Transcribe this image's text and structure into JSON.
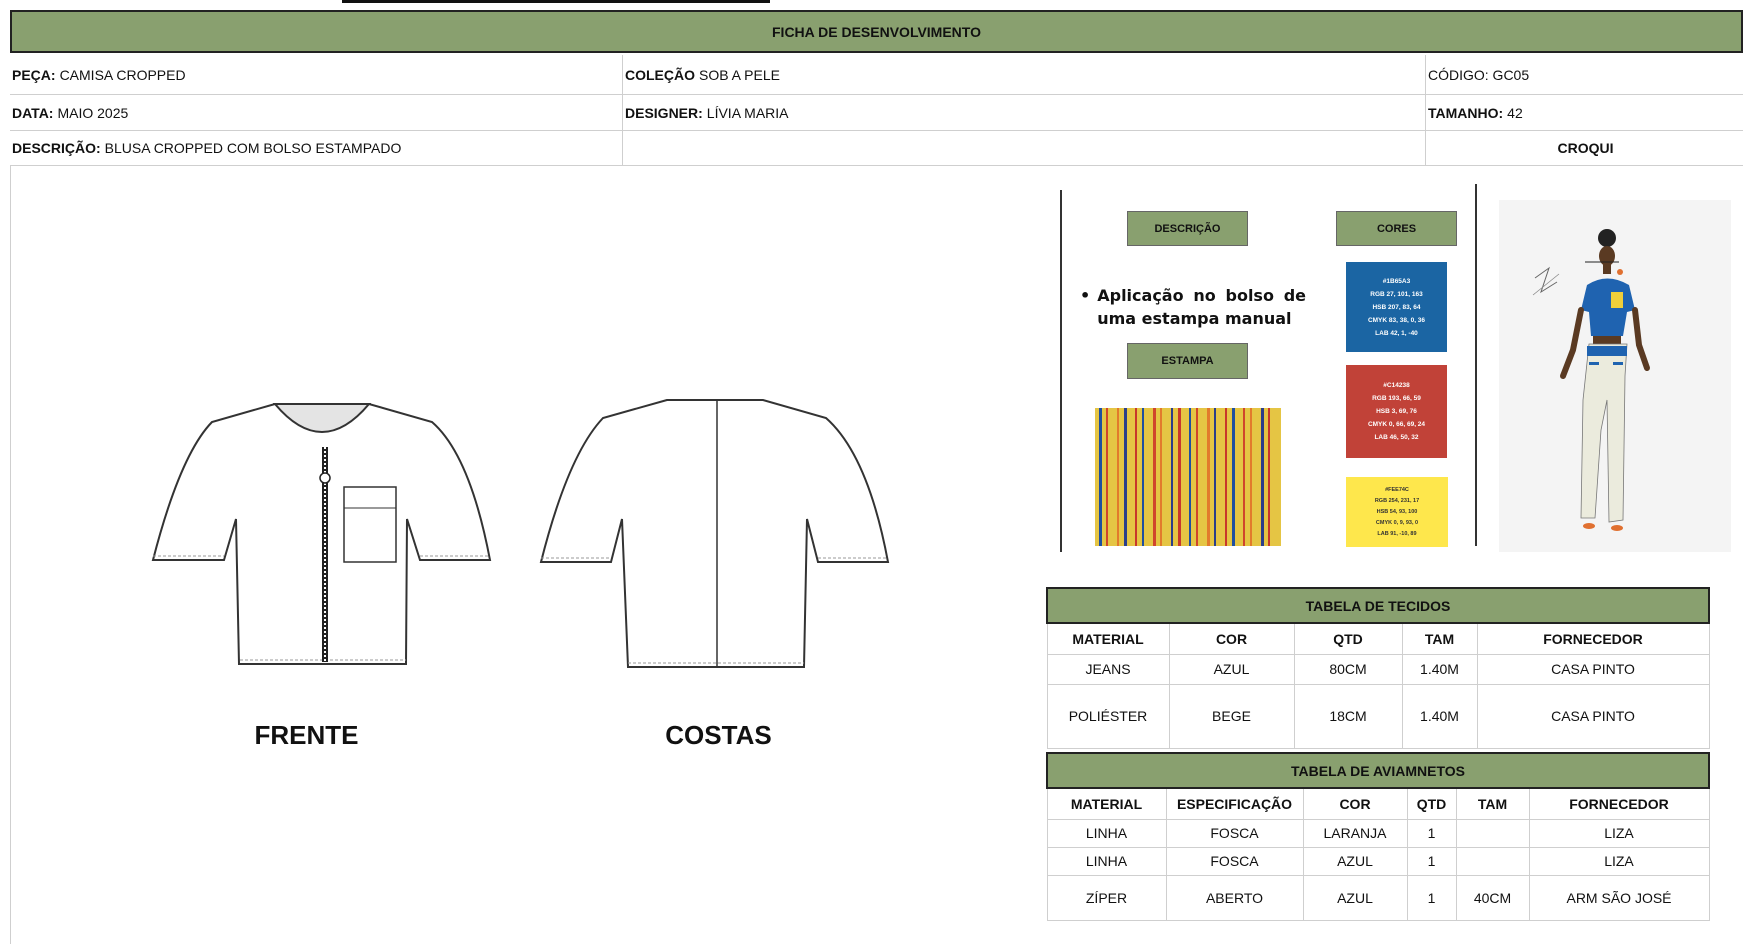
{
  "header": {
    "title": "FICHA DE DESENVOLVIMENTO"
  },
  "info": {
    "peca_label": "PEÇA:",
    "peca_value": "CAMISA CROPPED",
    "colecao_label": "COLEÇÃO",
    "colecao_value": "SOB A PELE",
    "codigo": "CÓDIGO: GC05",
    "data_label": "DATA:",
    "data_value": "MAIO 2025",
    "designer_label": "DESIGNER:",
    "designer_value": "LÍVIA MARIA",
    "tamanho_label": "TAMANHO:",
    "tamanho_value": "42",
    "descricao_label": "DESCRIÇÃO:",
    "descricao_value": "BLUSA CROPPED COM BOLSO ESTAMPADO",
    "croqui": "CROQUI"
  },
  "views": {
    "front": "FRENTE",
    "back": "COSTAS"
  },
  "panel": {
    "descricao_btn": "DESCRIÇÃO",
    "cores_btn": "CORES",
    "estampa_btn": "ESTAMPA",
    "description": "Aplicação no bolso de uma estampa manual"
  },
  "colors": [
    {
      "hex": "#1B65A3",
      "lines": [
        "#1B65A3",
        "RGB 27, 101, 163",
        "HSB 207, 83, 64",
        "CMYK 83, 38, 0, 36",
        "LAB 42, 1, -40"
      ],
      "text_color": "#ffffff"
    },
    {
      "hex": "#C14238",
      "lines": [
        "#C14238",
        "RGB 193, 66, 59",
        "HSB 3, 69, 76",
        "CMYK 0, 66, 69, 24",
        "LAB 46, 50, 32"
      ],
      "text_color": "#ffffff"
    },
    {
      "hex": "#FEE74C",
      "lines": [
        "#FEE74C",
        "RGB 254, 231, 17",
        "HSB 54, 93, 100",
        "CMYK 0, 9, 93, 0",
        "LAB 91, -10, 89"
      ],
      "text_color": "#333333"
    }
  ],
  "fabrics": {
    "title": "TABELA DE TECIDOS",
    "columns": [
      "MATERIAL",
      "COR",
      "QTD",
      "TAM",
      "FORNECEDOR"
    ],
    "rows": [
      [
        "JEANS",
        "AZUL",
        "80CM",
        "1.40M",
        "CASA PINTO"
      ],
      [
        "POLIÉSTER",
        "BEGE",
        "18CM",
        "1.40M",
        "CASA PINTO"
      ]
    ]
  },
  "trims": {
    "title": "TABELA DE AVIAMNETOS",
    "columns": [
      "MATERIAL",
      "ESPECIFICAÇÃO",
      "COR",
      "QTD",
      "TAM",
      "FORNECEDOR"
    ],
    "rows": [
      [
        "LINHA",
        "FOSCA",
        "LARANJA",
        "1",
        "",
        "LIZA"
      ],
      [
        "LINHA",
        "FOSCA",
        "AZUL",
        "1",
        "",
        "LIZA"
      ],
      [
        "ZÍPER",
        "ABERTO",
        "AZUL",
        "1",
        "40CM",
        "ARM SÃO JOSÉ"
      ]
    ]
  }
}
